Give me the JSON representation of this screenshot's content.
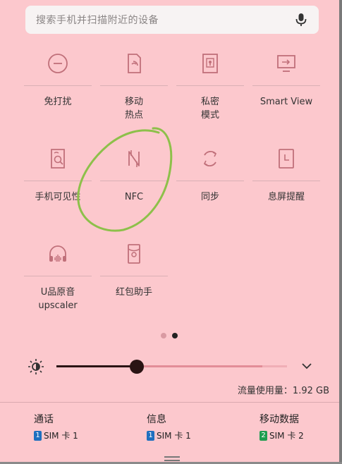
{
  "search": {
    "placeholder": "搜索手机并扫描附近的设备",
    "icon": "mic-icon"
  },
  "tiles": [
    {
      "id": "do-not-disturb",
      "label": "免打扰",
      "icon": "minus-circle-icon",
      "active": false
    },
    {
      "id": "hotspot",
      "label": "移动\n热点",
      "icon": "hotspot-icon",
      "active": false
    },
    {
      "id": "private-mode",
      "label": "私密\n模式",
      "icon": "private-mode-icon",
      "active": false
    },
    {
      "id": "smart-view",
      "label": "Smart View",
      "icon": "cast-screen-icon",
      "active": false
    },
    {
      "id": "visibility",
      "label": "手机可见性",
      "icon": "device-visibility-icon",
      "active": false
    },
    {
      "id": "nfc",
      "label": "NFC",
      "icon": "nfc-icon",
      "active": false
    },
    {
      "id": "sync",
      "label": "同步",
      "icon": "sync-icon",
      "active": false
    },
    {
      "id": "screen-reminder",
      "label": "息屏提醒",
      "icon": "always-on-display-icon",
      "active": false
    },
    {
      "id": "uhq-upscaler",
      "label": "U品原音\nupscaler",
      "icon": "headphones-icon",
      "active": false
    },
    {
      "id": "red-packet",
      "label": "红包助手",
      "icon": "red-packet-icon",
      "active": false
    }
  ],
  "pager": {
    "page_count": 2,
    "current_page": 2
  },
  "brightness": {
    "level": 0.35,
    "icon": "brightness-icon",
    "expand_icon": "chevron-down-icon"
  },
  "usage": {
    "text": "流量使用量：1.92 GB"
  },
  "sims": [
    {
      "name": "通话",
      "slot": "1",
      "sim_text": "SIM 卡 1",
      "badge_color": "#1f6fbf"
    },
    {
      "name": "信息",
      "slot": "1",
      "sim_text": "SIM 卡 1",
      "badge_color": "#1f6fbf"
    },
    {
      "name": "移动数据",
      "slot": "2",
      "sim_text": "SIM 卡 2",
      "badge_color": "#1e9d4f"
    }
  ],
  "colors": {
    "background": "#fcc8cd",
    "icon_stroke": "#c0707a",
    "annotation": "#8dc04a"
  }
}
